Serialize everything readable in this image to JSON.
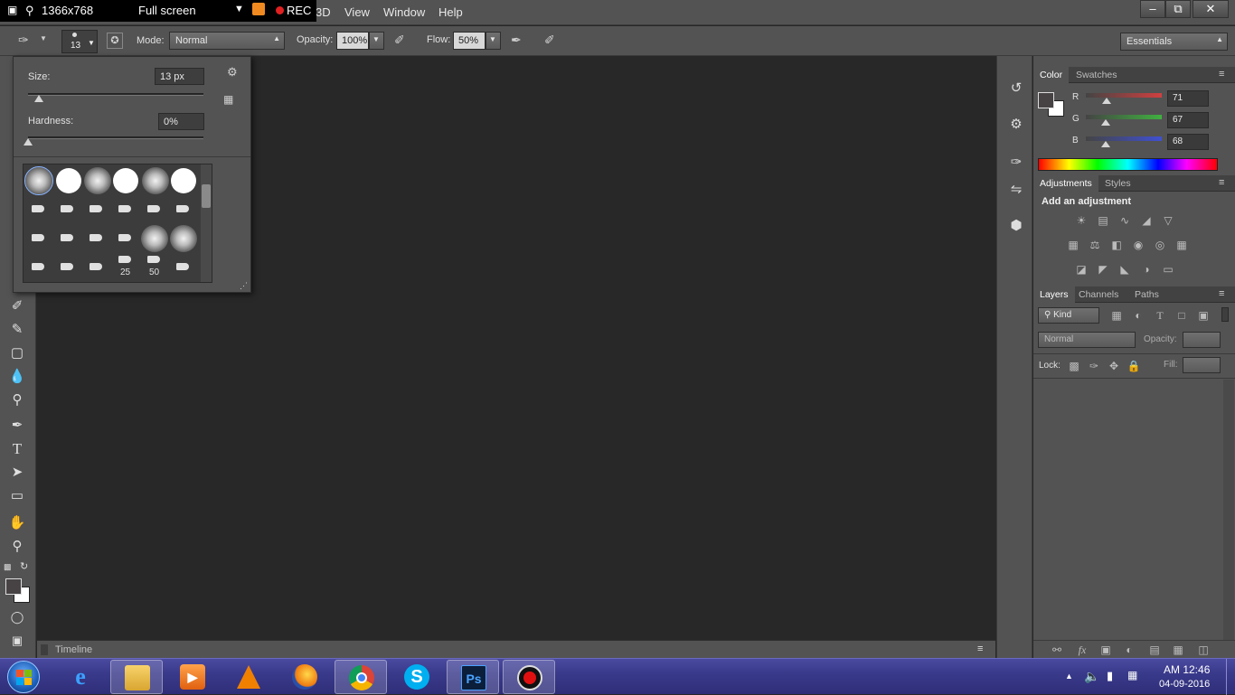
{
  "recorder": {
    "resolution": "1366x768",
    "mode": "Full screen",
    "rec_label": "REC"
  },
  "menu": {
    "items": [
      "3D",
      "View",
      "Window",
      "Help"
    ]
  },
  "window_controls": {
    "minimize": "–",
    "restore": "⧉",
    "close": "✕"
  },
  "options": {
    "brush_size": "13",
    "mode_label": "Mode:",
    "mode_value": "Normal",
    "opacity_label": "Opacity:",
    "opacity_value": "100%",
    "flow_label": "Flow:",
    "flow_value": "50%",
    "workspace": "Essentials"
  },
  "brush_popup": {
    "size_label": "Size:",
    "size_value": "13 px",
    "hardness_label": "Hardness:",
    "hardness_value": "0%",
    "size_level": 0.06,
    "hardness_level": 0.0,
    "preset_labels": [
      "25",
      "50"
    ]
  },
  "timeline": {
    "label": "Timeline"
  },
  "color_panel": {
    "tabs": [
      "Color",
      "Swatches"
    ],
    "channels": [
      {
        "name": "R",
        "value": "71",
        "color": "#d04040"
      },
      {
        "name": "G",
        "value": "67",
        "color": "#40b040"
      },
      {
        "name": "B",
        "value": "68",
        "color": "#4050d0"
      }
    ]
  },
  "adjustments_panel": {
    "tabs": [
      "Adjustments",
      "Styles"
    ],
    "heading": "Add an adjustment"
  },
  "layers_panel": {
    "tabs": [
      "Layers",
      "Channels",
      "Paths"
    ],
    "kind_label": "Kind",
    "blend_mode": "Normal",
    "opacity_label": "Opacity:",
    "lock_label": "Lock:",
    "fill_label": "Fill:"
  },
  "taskbar": {
    "apps": [
      "start",
      "internet-explorer",
      "file-explorer",
      "media-player",
      "vlc",
      "firefox",
      "chrome",
      "skype",
      "photoshop",
      "recorder"
    ],
    "ps_label": "Ps",
    "skype_label": "S",
    "time": "AM 12:46",
    "date": "04-09-2016"
  }
}
